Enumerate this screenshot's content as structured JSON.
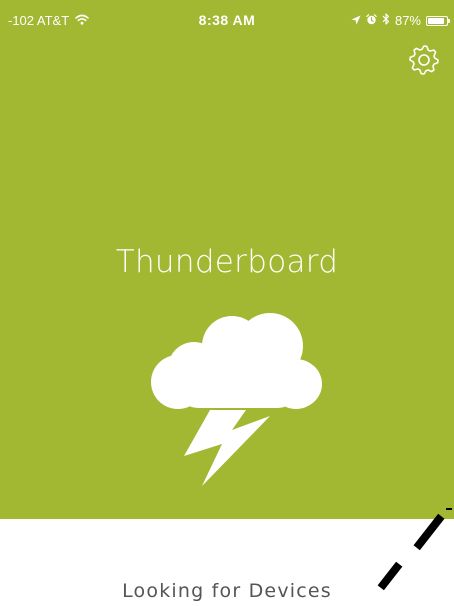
{
  "status_bar": {
    "carrier": "-102 AT&T",
    "time": "8:38 AM",
    "battery_percent": "87%",
    "battery_level": 0.87,
    "icons": [
      "wifi-icon",
      "location-arrow-icon",
      "alarm-icon",
      "bluetooth-icon",
      "battery-icon"
    ]
  },
  "header": {
    "settings_icon": "gear-icon"
  },
  "hero": {
    "title": "Thunderboard",
    "logo_icon": "cloud-lightning-icon"
  },
  "status": {
    "message": "Looking for Devices"
  },
  "colors": {
    "brand": "#a2b832",
    "background": "#ffffff",
    "spinner": "#000000",
    "text_muted": "#555555"
  }
}
